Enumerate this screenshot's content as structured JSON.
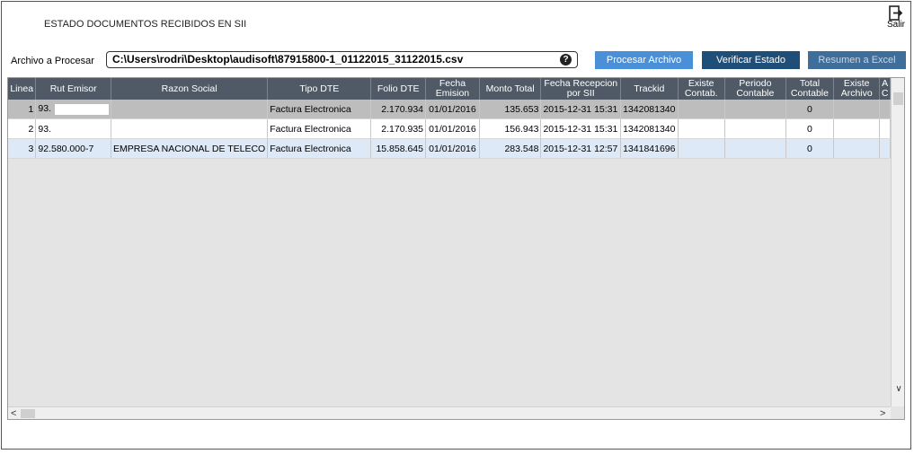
{
  "header": {
    "title": "ESTADO DOCUMENTOS RECIBIDOS EN SII",
    "exit_label": "Salir"
  },
  "file": {
    "label": "Archivo a Procesar",
    "path": "C:\\Users\\rodri\\Desktop\\audisoft\\87915800-1_01122015_31122015.csv",
    "help_icon": "?"
  },
  "buttons": {
    "process": "Procesar Archivo",
    "verify": "Verificar Estado",
    "summary": "Resumen a Excel"
  },
  "table": {
    "columns": [
      "Linea",
      "Rut Emisor",
      "Razon Social",
      "Tipo DTE",
      "Folio DTE",
      "Fecha Emision",
      "Monto Total",
      "Fecha Recepcion por SII",
      "Trackid",
      "Existe Contab.",
      "Periodo Contable",
      "Total Contable",
      "Existe Archivo",
      "A C"
    ],
    "rows": [
      {
        "linea": "1",
        "rut": "93.",
        "razon": "",
        "tipo": "Factura Electronica",
        "folio": "2.170.934",
        "fecha": "01/01/2016",
        "monto": "135.653",
        "recepcion": "2015-12-31 15:31",
        "trackid": "1342081340",
        "existe_contab": "",
        "periodo": "",
        "total_contable": "0",
        "existe_archivo": ""
      },
      {
        "linea": "2",
        "rut": "93.",
        "razon": "",
        "tipo": "Factura Electronica",
        "folio": "2.170.935",
        "fecha": "01/01/2016",
        "monto": "156.943",
        "recepcion": "2015-12-31 15:31",
        "trackid": "1342081340",
        "existe_contab": "",
        "periodo": "",
        "total_contable": "0",
        "existe_archivo": ""
      },
      {
        "linea": "3",
        "rut": "92.580.000-7",
        "razon": "EMPRESA NACIONAL DE TELECO",
        "tipo": "Factura Electronica",
        "folio": "15.858.645",
        "fecha": "01/01/2016",
        "monto": "283.548",
        "recepcion": "2015-12-31 12:57",
        "trackid": "1341841696",
        "existe_contab": "",
        "periodo": "",
        "total_contable": "0",
        "existe_archivo": ""
      }
    ]
  },
  "colors": {
    "header_bg": "#505a66",
    "selected_row": "#bdbdbd",
    "alt_row": "#dde9f7",
    "btn_process": "#4a90d9",
    "btn_verify": "#1f4e79"
  },
  "icons": {
    "exit": "exit-icon",
    "help": "question-icon",
    "scroll_up": "chevron-up-icon",
    "scroll_down": "chevron-down-icon",
    "scroll_left": "chevron-left-icon",
    "scroll_right": "chevron-right-icon"
  }
}
